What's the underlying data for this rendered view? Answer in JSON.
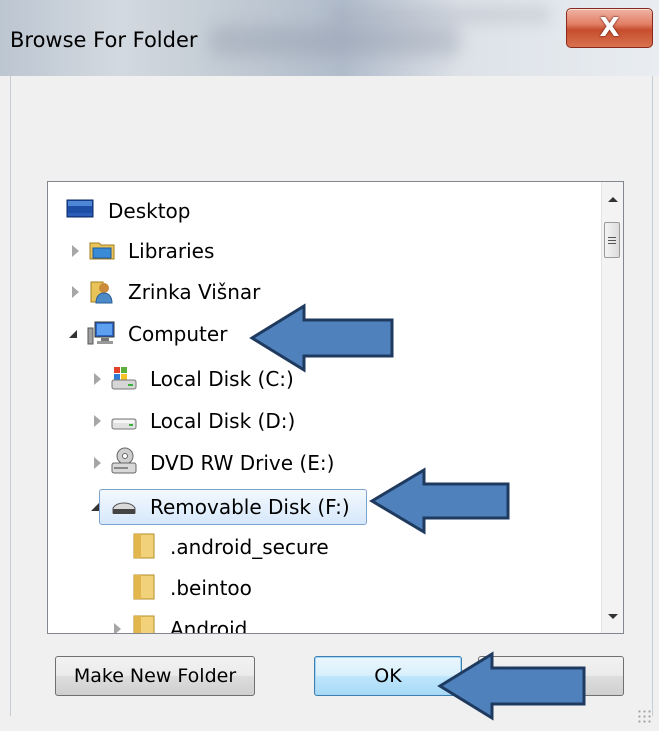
{
  "window": {
    "title": "Browse For Folder",
    "close_symbol": "X"
  },
  "tree": {
    "items": [
      {
        "label": "Desktop",
        "icon": "desktop-icon",
        "state": "none"
      },
      {
        "label": "Libraries",
        "icon": "libraries-icon",
        "state": "collapsed"
      },
      {
        "label": "Zrinka Višnar",
        "icon": "user-folder-icon",
        "state": "collapsed"
      },
      {
        "label": "Computer",
        "icon": "computer-icon",
        "state": "expanded"
      },
      {
        "label": "Local Disk (C:)",
        "icon": "windows-drive-icon",
        "state": "collapsed"
      },
      {
        "label": "Local Disk (D:)",
        "icon": "hard-drive-icon",
        "state": "collapsed"
      },
      {
        "label": "DVD RW Drive (E:)",
        "icon": "dvd-drive-icon",
        "state": "collapsed"
      },
      {
        "label": "Removable Disk (F:)",
        "icon": "removable-disk-icon",
        "state": "expanded",
        "selected": true
      },
      {
        "label": ".android_secure",
        "icon": "folder-icon",
        "state": "none"
      },
      {
        "label": ".beintoo",
        "icon": "folder-icon",
        "state": "none"
      },
      {
        "label": "Android",
        "icon": "folder-icon",
        "state": "collapsed"
      }
    ]
  },
  "buttons": {
    "make_new_folder": "Make New Folder",
    "ok": "OK"
  },
  "colors": {
    "arrow_fill": "#4f81bd",
    "arrow_stroke": "#1f3a5f",
    "selection": "#d7e8fb",
    "close_button": "#c64d2e"
  }
}
